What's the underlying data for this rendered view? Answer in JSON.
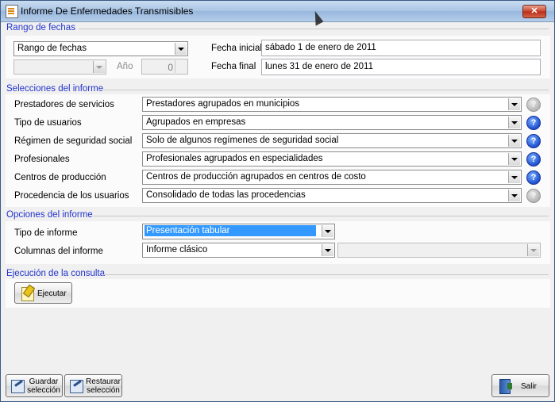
{
  "window": {
    "title": "Informe De Enfermedades Transmisibles",
    "close_label": "✕"
  },
  "date_range": {
    "section_title": "Rango de fechas",
    "range_type": "Rango de fechas",
    "period": "",
    "year_label": "Año",
    "year_value": "0",
    "start_label": "Fecha inicial",
    "start_value": "sábado 1 de enero de 2011",
    "end_label": "Fecha final",
    "end_value": "lunes 31 de enero de 2011"
  },
  "selections": {
    "section_title": "Selecciones del informe",
    "rows": [
      {
        "label": "Prestadores de servicios",
        "value": "Prestadores agrupados en municipios",
        "help_enabled": false
      },
      {
        "label": "Tipo de usuarios",
        "value": "Agrupados en empresas",
        "help_enabled": true
      },
      {
        "label": "Régimen de seguridad social",
        "value": "Solo de algunos regímenes de seguridad social",
        "help_enabled": true
      },
      {
        "label": "Profesionales",
        "value": "Profesionales agrupados en especialidades",
        "help_enabled": true
      },
      {
        "label": "Centros de producción",
        "value": "Centros de producción agrupados en centros de costo",
        "help_enabled": true
      },
      {
        "label": "Procedencia de los usuarios",
        "value": "Consolidado de todas las procedencias",
        "help_enabled": false
      }
    ],
    "help_label": "?"
  },
  "options": {
    "section_title": "Opciones del informe",
    "report_type_label": "Tipo de informe",
    "report_type_value": "Presentación tabular",
    "columns_label": "Columnas del informe",
    "columns_value": "Informe clásico",
    "columns_extra": ""
  },
  "execution": {
    "section_title": "Ejecución de la consulta",
    "run_label": "Ejecutar"
  },
  "footer": {
    "save_label": "Guardar selección",
    "restore_label": "Restaurar selección",
    "exit_label": "Salir"
  },
  "colors": {
    "section_title": "#2233cc",
    "selection": "#3399ff",
    "help": "#1e4fd0"
  }
}
